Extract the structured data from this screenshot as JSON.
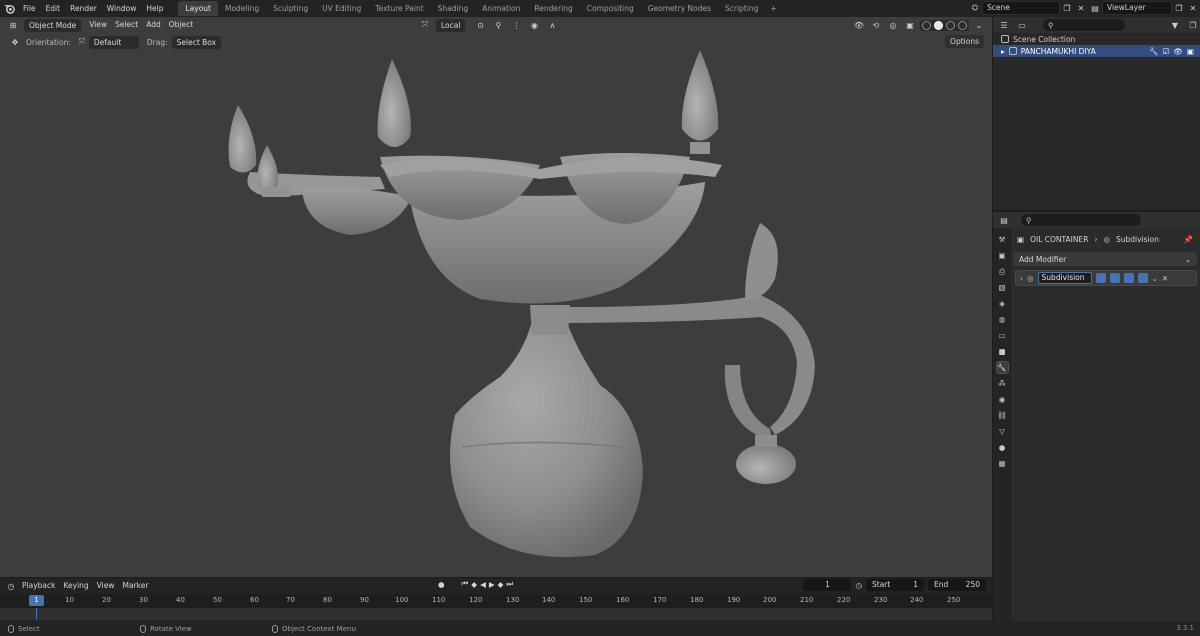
{
  "topbar": {
    "menus": [
      "File",
      "Edit",
      "Render",
      "Window",
      "Help"
    ],
    "workspaces": [
      "Layout",
      "Modeling",
      "Sculpting",
      "UV Editing",
      "Texture Paint",
      "Shading",
      "Animation",
      "Rendering",
      "Compositing",
      "Geometry Nodes",
      "Scripting"
    ],
    "active_workspace": "Layout",
    "add_workspace": "+",
    "scene": "Scene",
    "view_layer": "ViewLayer"
  },
  "viewport": {
    "mode": "Object Mode",
    "menus": [
      "View",
      "Select",
      "Add",
      "Object"
    ],
    "transform_space": "Local",
    "orientation_label": "Orientation:",
    "orientation_value": "Default",
    "drag_label": "Drag:",
    "drag_value": "Select Box",
    "options": "Options"
  },
  "outliner": {
    "root": "Scene Collection",
    "object": "PANCHAMUKHI DIYA"
  },
  "properties": {
    "object": "OIL CONTAINER",
    "modifier_crumb": "Subdivision",
    "add_modifier": "Add Modifier",
    "modifier_name": "Subdivision"
  },
  "timeline": {
    "menus": [
      "Playback",
      "Keying",
      "View",
      "Marker"
    ],
    "current_frame": "1",
    "start_label": "Start",
    "start": "1",
    "end_label": "End",
    "end": "250",
    "ruler_current": "1",
    "ticks": [
      "10",
      "20",
      "30",
      "40",
      "50",
      "60",
      "70",
      "80",
      "90",
      "100",
      "110",
      "120",
      "130",
      "140",
      "150",
      "160",
      "170",
      "180",
      "190",
      "200",
      "210",
      "220",
      "230",
      "240",
      "250"
    ]
  },
  "statusbar": {
    "select": "Select",
    "rotate": "Rotate View",
    "context": "Object Context Menu",
    "version": "3.3.1"
  },
  "colors": {
    "accent": "#4772b3",
    "selected_row": "#334d80",
    "viewport_bg": "#3d3d3d"
  }
}
